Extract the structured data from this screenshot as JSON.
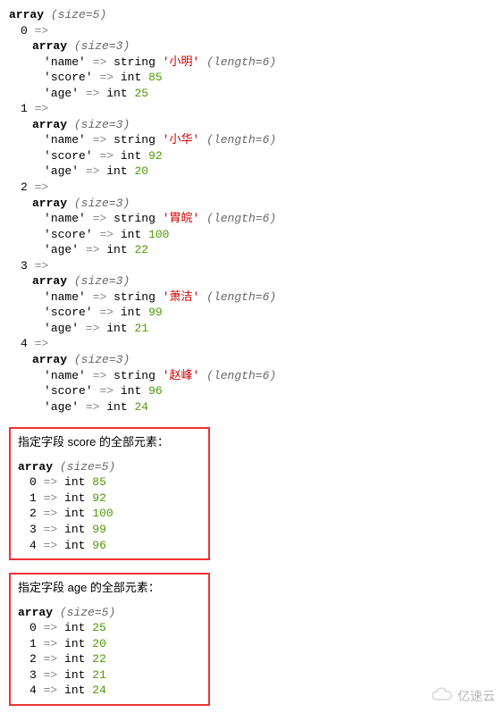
{
  "outer": {
    "size": 5,
    "records": [
      {
        "idx": 0,
        "size": 3,
        "name": "小明",
        "name_len": 6,
        "score": 85,
        "age": 25
      },
      {
        "idx": 1,
        "size": 3,
        "name": "小华",
        "name_len": 6,
        "score": 92,
        "age": 20
      },
      {
        "idx": 2,
        "size": 3,
        "name": "胃皖",
        "name_len": 6,
        "score": 100,
        "age": 22
      },
      {
        "idx": 3,
        "size": 3,
        "name": "萧洁",
        "name_len": 6,
        "score": 99,
        "age": 21
      },
      {
        "idx": 4,
        "size": 3,
        "name": "赵峰",
        "name_len": 6,
        "score": 96,
        "age": 24
      }
    ],
    "keys": {
      "name": "name",
      "score": "score",
      "age": "age"
    },
    "tokens": {
      "array": "array",
      "size_label": "size=",
      "arrow": "=>",
      "string": "string",
      "int": "int",
      "length_label": "length="
    }
  },
  "boxes": [
    {
      "title": "指定字段 score 的全部元素：",
      "size": 5,
      "items": [
        {
          "idx": 0,
          "value": 85
        },
        {
          "idx": 1,
          "value": 92
        },
        {
          "idx": 2,
          "value": 100
        },
        {
          "idx": 3,
          "value": 99
        },
        {
          "idx": 4,
          "value": 96
        }
      ]
    },
    {
      "title": "指定字段 age 的全部元素：",
      "size": 5,
      "items": [
        {
          "idx": 0,
          "value": 25
        },
        {
          "idx": 1,
          "value": 20
        },
        {
          "idx": 2,
          "value": 22
        },
        {
          "idx": 3,
          "value": 21
        },
        {
          "idx": 4,
          "value": 24
        }
      ]
    }
  ],
  "watermark": {
    "text": "亿速云"
  },
  "chart_data": {
    "type": "table",
    "records": [
      {
        "name": "小明",
        "score": 85,
        "age": 25
      },
      {
        "name": "小华",
        "score": 92,
        "age": 20
      },
      {
        "name": "胃皖",
        "score": 100,
        "age": 22
      },
      {
        "name": "萧洁",
        "score": 99,
        "age": 21
      },
      {
        "name": "赵峰",
        "score": 96,
        "age": 24
      }
    ],
    "columns": [
      "name",
      "score",
      "age"
    ],
    "extracted": {
      "score": [
        85,
        92,
        100,
        99,
        96
      ],
      "age": [
        25,
        20,
        22,
        21,
        24
      ]
    }
  }
}
